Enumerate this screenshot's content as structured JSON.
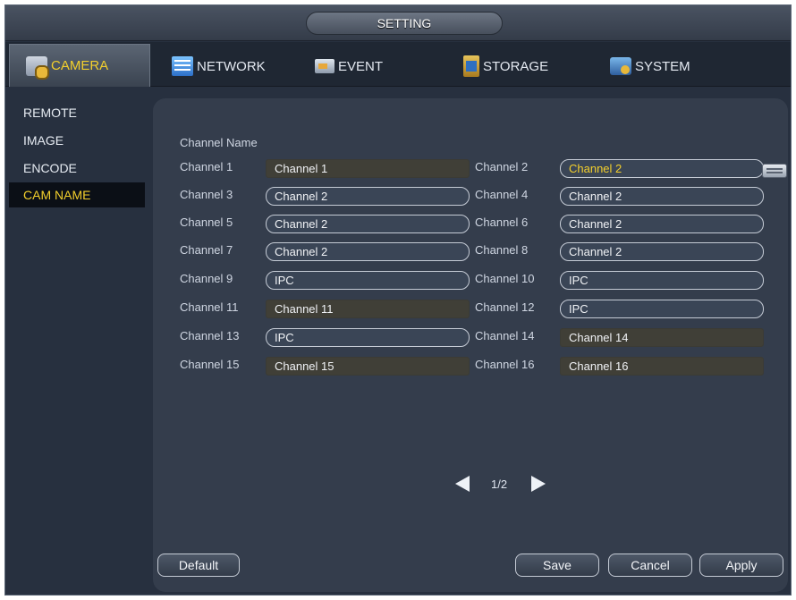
{
  "window": {
    "title": "SETTING"
  },
  "tabs": [
    {
      "label": "CAMERA",
      "icon": "camera-icon",
      "active": true
    },
    {
      "label": "NETWORK",
      "icon": "network-icon"
    },
    {
      "label": "EVENT",
      "icon": "event-icon"
    },
    {
      "label": "STORAGE",
      "icon": "storage-icon"
    },
    {
      "label": "SYSTEM",
      "icon": "system-icon"
    }
  ],
  "sidebar": {
    "items": [
      {
        "label": "REMOTE"
      },
      {
        "label": "IMAGE"
      },
      {
        "label": "ENCODE"
      },
      {
        "label": "CAM NAME",
        "active": true
      }
    ]
  },
  "main": {
    "section_label": "Channel Name",
    "channels": [
      {
        "label": "Channel 1",
        "value": "Channel 1"
      },
      {
        "label": "Channel 2",
        "value": "Channel 2"
      },
      {
        "label": "Channel 3",
        "value": "Channel 2"
      },
      {
        "label": "Channel 4",
        "value": "Channel 2"
      },
      {
        "label": "Channel 5",
        "value": "Channel 2"
      },
      {
        "label": "Channel 6",
        "value": "Channel 2"
      },
      {
        "label": "Channel 7",
        "value": "Channel 2"
      },
      {
        "label": "Channel 8",
        "value": "Channel 2"
      },
      {
        "label": "Channel 9",
        "value": "IPC"
      },
      {
        "label": "Channel 10",
        "value": "IPC"
      },
      {
        "label": "Channel 11",
        "value": "Channel 11"
      },
      {
        "label": "Channel 12",
        "value": "IPC"
      },
      {
        "label": "Channel 13",
        "value": "IPC"
      },
      {
        "label": "Channel 14",
        "value": "Channel 14"
      },
      {
        "label": "Channel 15",
        "value": "Channel 15"
      },
      {
        "label": "Channel 16",
        "value": "Channel 16"
      }
    ],
    "pager": {
      "text": "1/2"
    }
  },
  "buttons": {
    "default": "Default",
    "save": "Save",
    "cancel": "Cancel",
    "apply": "Apply"
  },
  "colors": {
    "background": "#27303f",
    "panel": "#343d4c",
    "accent": "#f3cf2c"
  }
}
